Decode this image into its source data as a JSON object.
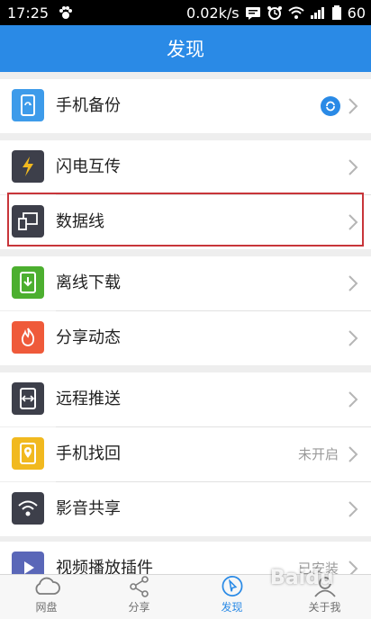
{
  "statusbar": {
    "time": "17:25",
    "speed": "0.02k/s",
    "battery": "60"
  },
  "appbar": {
    "title": "发现"
  },
  "items": [
    {
      "label": "手机备份",
      "icon": "phone-backup-icon",
      "color": "#3d9bea"
    },
    {
      "label": "闪电互传",
      "icon": "lightning-icon",
      "color": "#3d3f4a"
    },
    {
      "label": "数据线",
      "icon": "data-cable-icon",
      "color": "#3d3f4a"
    },
    {
      "label": "离线下载",
      "icon": "offline-download-icon",
      "color": "#4caf2f"
    },
    {
      "label": "分享动态",
      "icon": "flame-icon",
      "color": "#ef5a3a"
    },
    {
      "label": "远程推送",
      "icon": "remote-push-icon",
      "color": "#3d3f4a"
    },
    {
      "label": "手机找回",
      "icon": "phone-find-icon",
      "color": "#f1b91f",
      "status": "未开启"
    },
    {
      "label": "影音共享",
      "icon": "wifi-share-icon",
      "color": "#3d3f4a"
    },
    {
      "label": "视频播放插件",
      "icon": "video-plugin-icon",
      "color": "#5a67b8",
      "status": "已安装"
    }
  ],
  "tabs": [
    {
      "label": "网盘",
      "icon": "cloud-icon"
    },
    {
      "label": "分享",
      "icon": "share-icon"
    },
    {
      "label": "发现",
      "icon": "compass-icon",
      "active": true
    },
    {
      "label": "关于我",
      "icon": "person-icon"
    }
  ],
  "watermark": "Baidu"
}
